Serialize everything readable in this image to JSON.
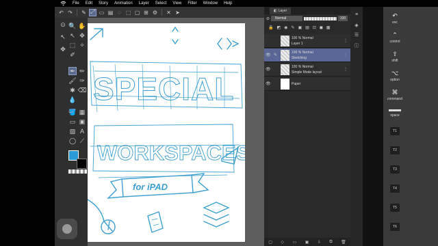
{
  "menu": [
    "File",
    "Edit",
    "Story",
    "Animation",
    "Layer",
    "Select",
    "View",
    "Filter",
    "Window",
    "Help"
  ],
  "toolbar_icons": [
    "undo-icon",
    "redo-icon",
    "pen-cursor-icon",
    "transform-icon",
    "clear-icon",
    "fill-icon",
    "lasso-icon",
    "select-icon",
    "deselect-icon",
    "invert-icon",
    "settings-icon",
    "close-icon",
    "cursor-icon"
  ],
  "colors": {
    "main": "#2b9ad8",
    "sub": "#000000",
    "accent": "#5a6796"
  },
  "layer_panel": {
    "tab_label": "Layer",
    "blend_mode": "Normal",
    "opacity": "100",
    "layers": [
      {
        "blend": "100 % Normal",
        "name": "Layer 1",
        "selected": false
      },
      {
        "blend": "100 % Normal",
        "name": "Sketching",
        "selected": true
      },
      {
        "blend": "100 % Normal",
        "name": "Simple Mode layout",
        "selected": false
      },
      {
        "blend": "",
        "name": "Paper",
        "selected": false
      }
    ]
  },
  "modifier_keys": [
    {
      "label": "esc",
      "icon": "esc-icon"
    },
    {
      "label": "control",
      "icon": "control-icon"
    },
    {
      "label": "shift",
      "icon": "shift-icon"
    },
    {
      "label": "option",
      "icon": "option-icon"
    },
    {
      "label": "command",
      "icon": "command-icon"
    },
    {
      "label": "space",
      "icon": "space-icon"
    }
  ],
  "tkeys": [
    "T1",
    "T2",
    "T3",
    "T4",
    "T5",
    "T6"
  ],
  "artwork": {
    "line1": "SPECIAL",
    "line2": "WORKSPACES",
    "ribbon": "for iPAD"
  }
}
